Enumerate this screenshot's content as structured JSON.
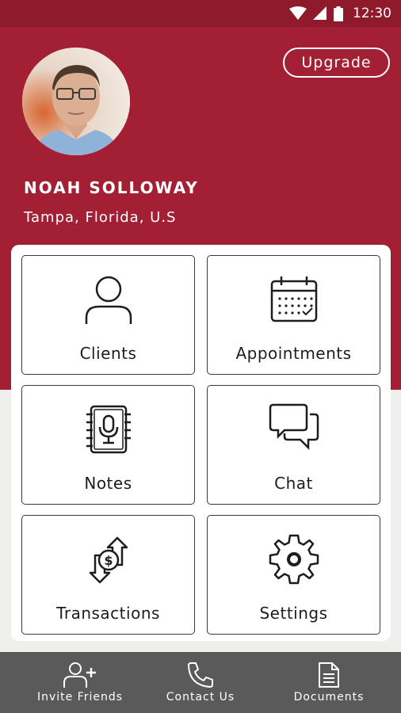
{
  "status_bar": {
    "time": "12:30",
    "icons": [
      "wifi-icon",
      "signal-icon",
      "battery-icon"
    ]
  },
  "header": {
    "upgrade_label": "Upgrade",
    "avatar_icon": "avatar",
    "name": "NOAH SOLLOWAY",
    "location": "Tampa, Florida, U.S"
  },
  "tiles": [
    {
      "label": "Clients",
      "icon": "user-icon"
    },
    {
      "label": "Appointments",
      "icon": "calendar-icon"
    },
    {
      "label": "Notes",
      "icon": "notebook-microphone-icon"
    },
    {
      "label": "Chat",
      "icon": "chat-bubbles-icon"
    },
    {
      "label": "Transactions",
      "icon": "money-transfer-icon"
    },
    {
      "label": "Settings",
      "icon": "gear-icon"
    }
  ],
  "bottom_nav": [
    {
      "label": "Invite Friends",
      "icon": "add-user-icon"
    },
    {
      "label": "Contact Us",
      "icon": "phone-icon"
    },
    {
      "label": "Documents",
      "icon": "document-icon"
    }
  ],
  "colors": {
    "primary": "#a21f34",
    "status_bar": "#8f1a2b",
    "bottom_nav": "#5a5a5a",
    "background": "#efefed"
  }
}
